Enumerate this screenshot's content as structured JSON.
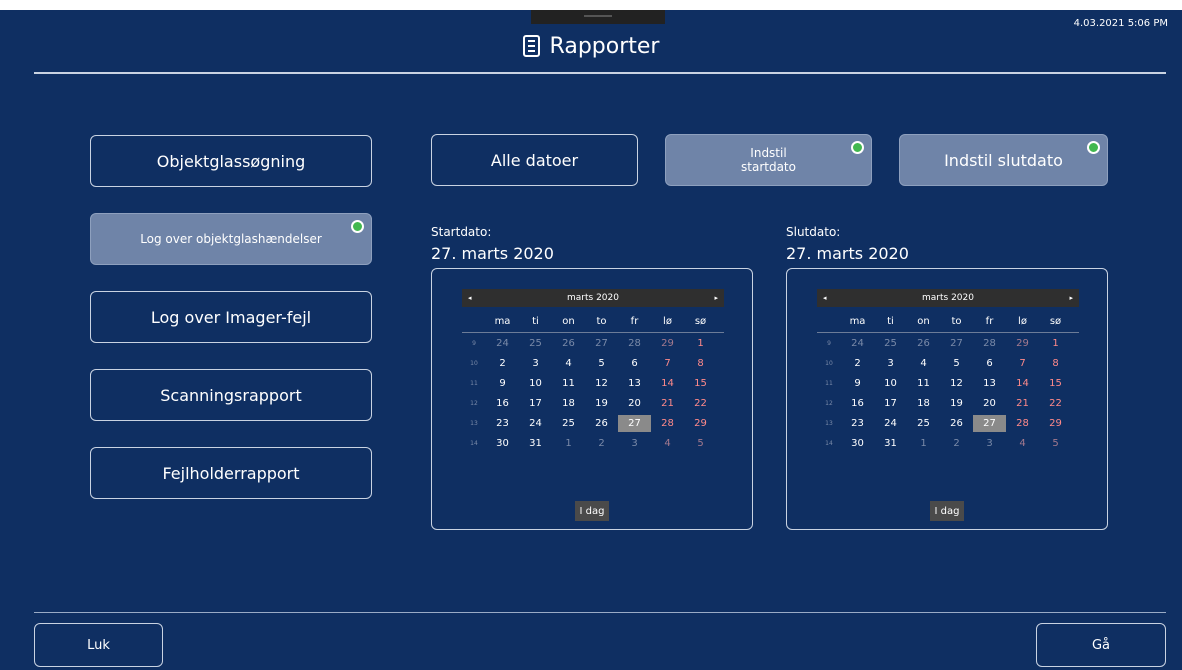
{
  "header": {
    "title": "Rapporter",
    "timestamp": "4.03.2021 5:06 PM",
    "icon": "report-icon"
  },
  "left_menu": [
    {
      "label": "Objektglassøgning",
      "selected": false
    },
    {
      "label": "Log over objektglashændelser",
      "selected": true
    },
    {
      "label": "Log over Imager-fejl",
      "selected": false
    },
    {
      "label": "Scanningsrapport",
      "selected": false
    },
    {
      "label": "Fejlholderrapport",
      "selected": false
    }
  ],
  "date_buttons": {
    "all_dates": "Alle datoer",
    "set_start": "Indstil startdato",
    "set_end": "Indstil slutdato"
  },
  "start": {
    "label": "Startdato:",
    "value": "27. marts 2020"
  },
  "end": {
    "label": "Slutdato:",
    "value": "27. marts 2020"
  },
  "calendar": {
    "month": "marts 2020",
    "prev": "◂",
    "next": "▸",
    "weekdays": [
      "ma",
      "ti",
      "on",
      "to",
      "fr",
      "lø",
      "sø"
    ],
    "weeks": [
      {
        "wk": "9",
        "days": [
          "24",
          "25",
          "26",
          "27",
          "28",
          "29",
          "1"
        ]
      },
      {
        "wk": "10",
        "days": [
          "2",
          "3",
          "4",
          "5",
          "6",
          "7",
          "8"
        ]
      },
      {
        "wk": "11",
        "days": [
          "9",
          "10",
          "11",
          "12",
          "13",
          "14",
          "15"
        ]
      },
      {
        "wk": "12",
        "days": [
          "16",
          "17",
          "18",
          "19",
          "20",
          "21",
          "22"
        ]
      },
      {
        "wk": "13",
        "days": [
          "23",
          "24",
          "25",
          "26",
          "27",
          "28",
          "29"
        ]
      },
      {
        "wk": "14",
        "days": [
          "30",
          "31",
          "1",
          "2",
          "3",
          "4",
          "5"
        ]
      }
    ],
    "selected_day": "27",
    "today": "I dag"
  },
  "footer": {
    "close": "Luk",
    "go": "Gå"
  },
  "colors": {
    "background": "#0f2f62",
    "selected_button": "#6f84a8",
    "indicator": "#42b84f",
    "weekend": "#ff8a8a"
  }
}
